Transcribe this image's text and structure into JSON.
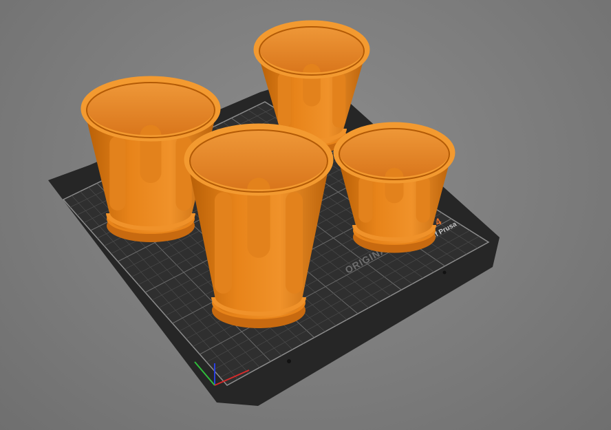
{
  "viewport": {
    "background_color": "#7c7c7c"
  },
  "print_bed": {
    "brand_text": "ORIGINAL",
    "model_text": "MK4",
    "maker_text": "by Josef Prusa",
    "sheet_color": "#2e2e2e",
    "grid_color": "#5a5a5a",
    "border_color": "#9a9a9a",
    "brand_text_color": "#6e6e6e",
    "model_text_color": "#e8702a",
    "maker_text_color": "#c8c8c8"
  },
  "objects": {
    "material_color": "#e07a10",
    "count": 4
  },
  "axes_gizmo": {
    "x_color": "#d62a2a",
    "y_color": "#2fbf3a",
    "z_color": "#2a3fe0"
  }
}
